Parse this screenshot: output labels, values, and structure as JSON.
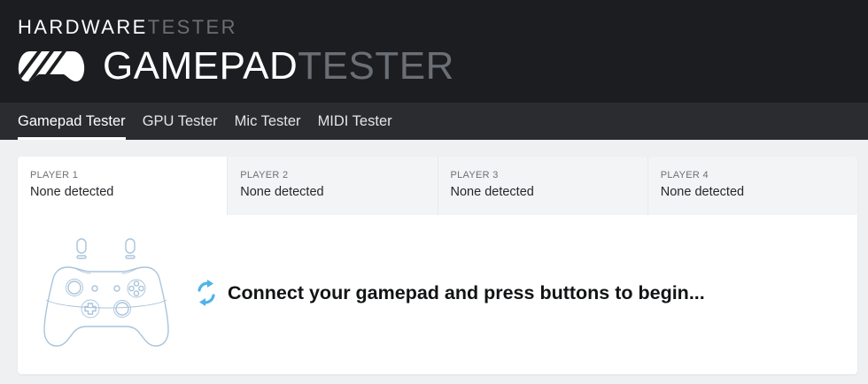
{
  "header": {
    "brand_small_primary": "HARDWARE",
    "brand_small_secondary": "TESTER",
    "brand_big_primary": "GAMEPAD",
    "brand_big_secondary": "TESTER",
    "logo_icon": "gamepad-stripes-icon"
  },
  "nav": {
    "items": [
      {
        "label": "Gamepad Tester",
        "active": true
      },
      {
        "label": "GPU Tester",
        "active": false
      },
      {
        "label": "Mic Tester",
        "active": false
      },
      {
        "label": "MIDI Tester",
        "active": false
      }
    ]
  },
  "players": [
    {
      "label": "PLAYER 1",
      "status": "None detected"
    },
    {
      "label": "PLAYER 2",
      "status": "None detected"
    },
    {
      "label": "PLAYER 3",
      "status": "None detected"
    },
    {
      "label": "PLAYER 4",
      "status": "None detected"
    }
  ],
  "main": {
    "message": "Connect your gamepad and press buttons to begin...",
    "message_icon": "refresh-icon",
    "illustration_icon": "controller-outline-icon"
  },
  "colors": {
    "header_bg": "#1b1d20",
    "nav_bg": "#2a2c30",
    "accent_blue": "#4fb3e8",
    "controller_line": "#a9c4dc"
  }
}
